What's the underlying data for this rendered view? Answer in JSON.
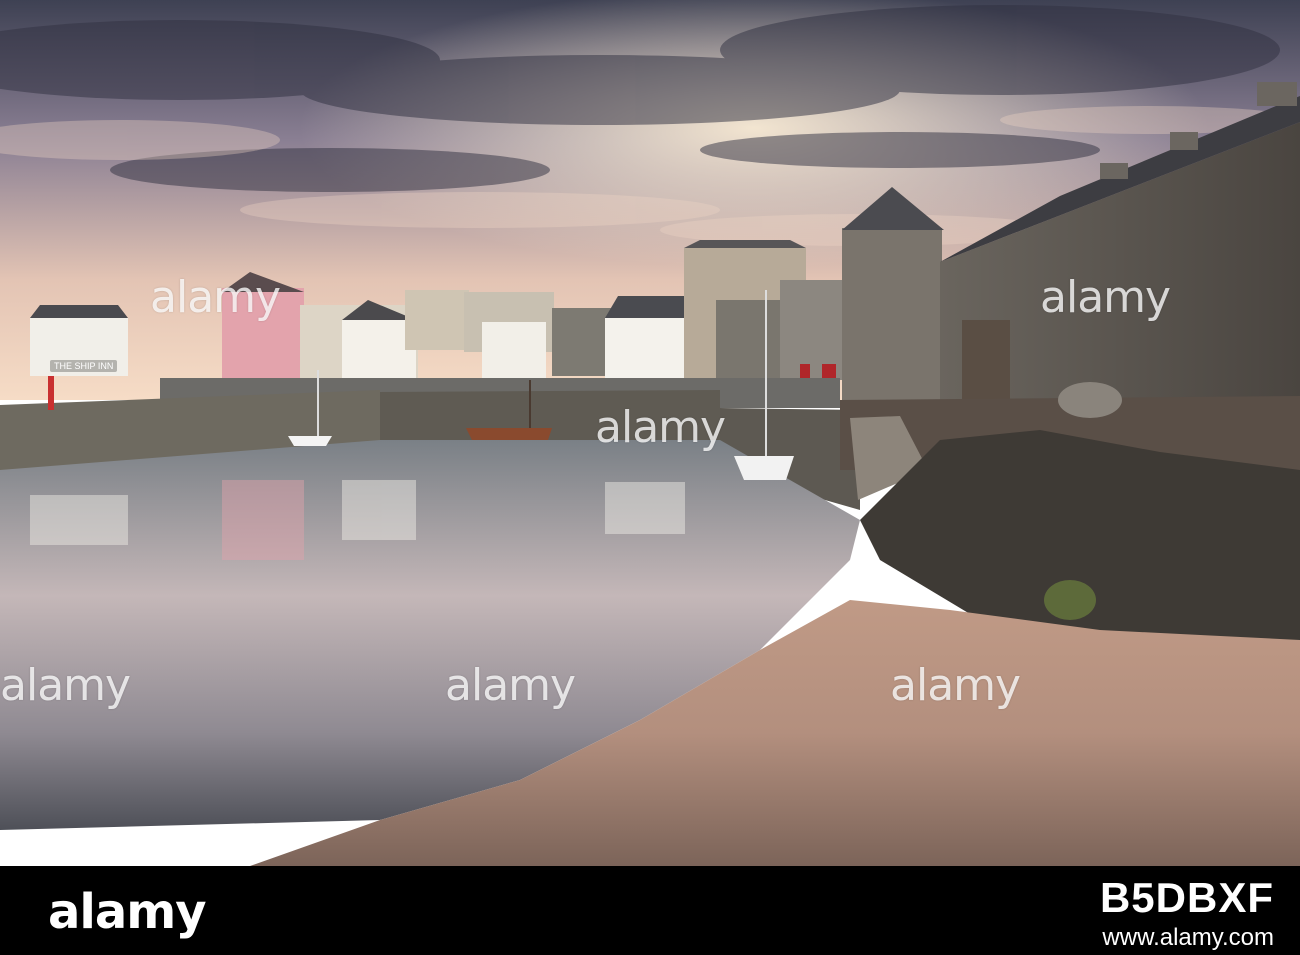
{
  "photo": {
    "subject": "",
    "pub_sign": "THE SHIP INN"
  },
  "watermarks": [
    "alamy",
    "alamy",
    "alamy",
    "alamy",
    "alamy",
    "alamy",
    "alamy",
    "alamy",
    "alamy",
    "alamy",
    "alamy",
    "alamy",
    "alamy",
    "alamy",
    "alamy",
    "alamy",
    "alamy",
    "alamy",
    "alamy",
    "alamy",
    "alamy",
    "alamy"
  ],
  "footer": {
    "logo": "alamy",
    "image_id": "B5DBXF",
    "url": "www.alamy.com"
  },
  "colors": {
    "footer_bg": "#000000",
    "sky_top": "#4a4a5e",
    "sky_glow": "#f3d2b2",
    "sand": "#c9a58e",
    "stone": "#5c5852"
  }
}
